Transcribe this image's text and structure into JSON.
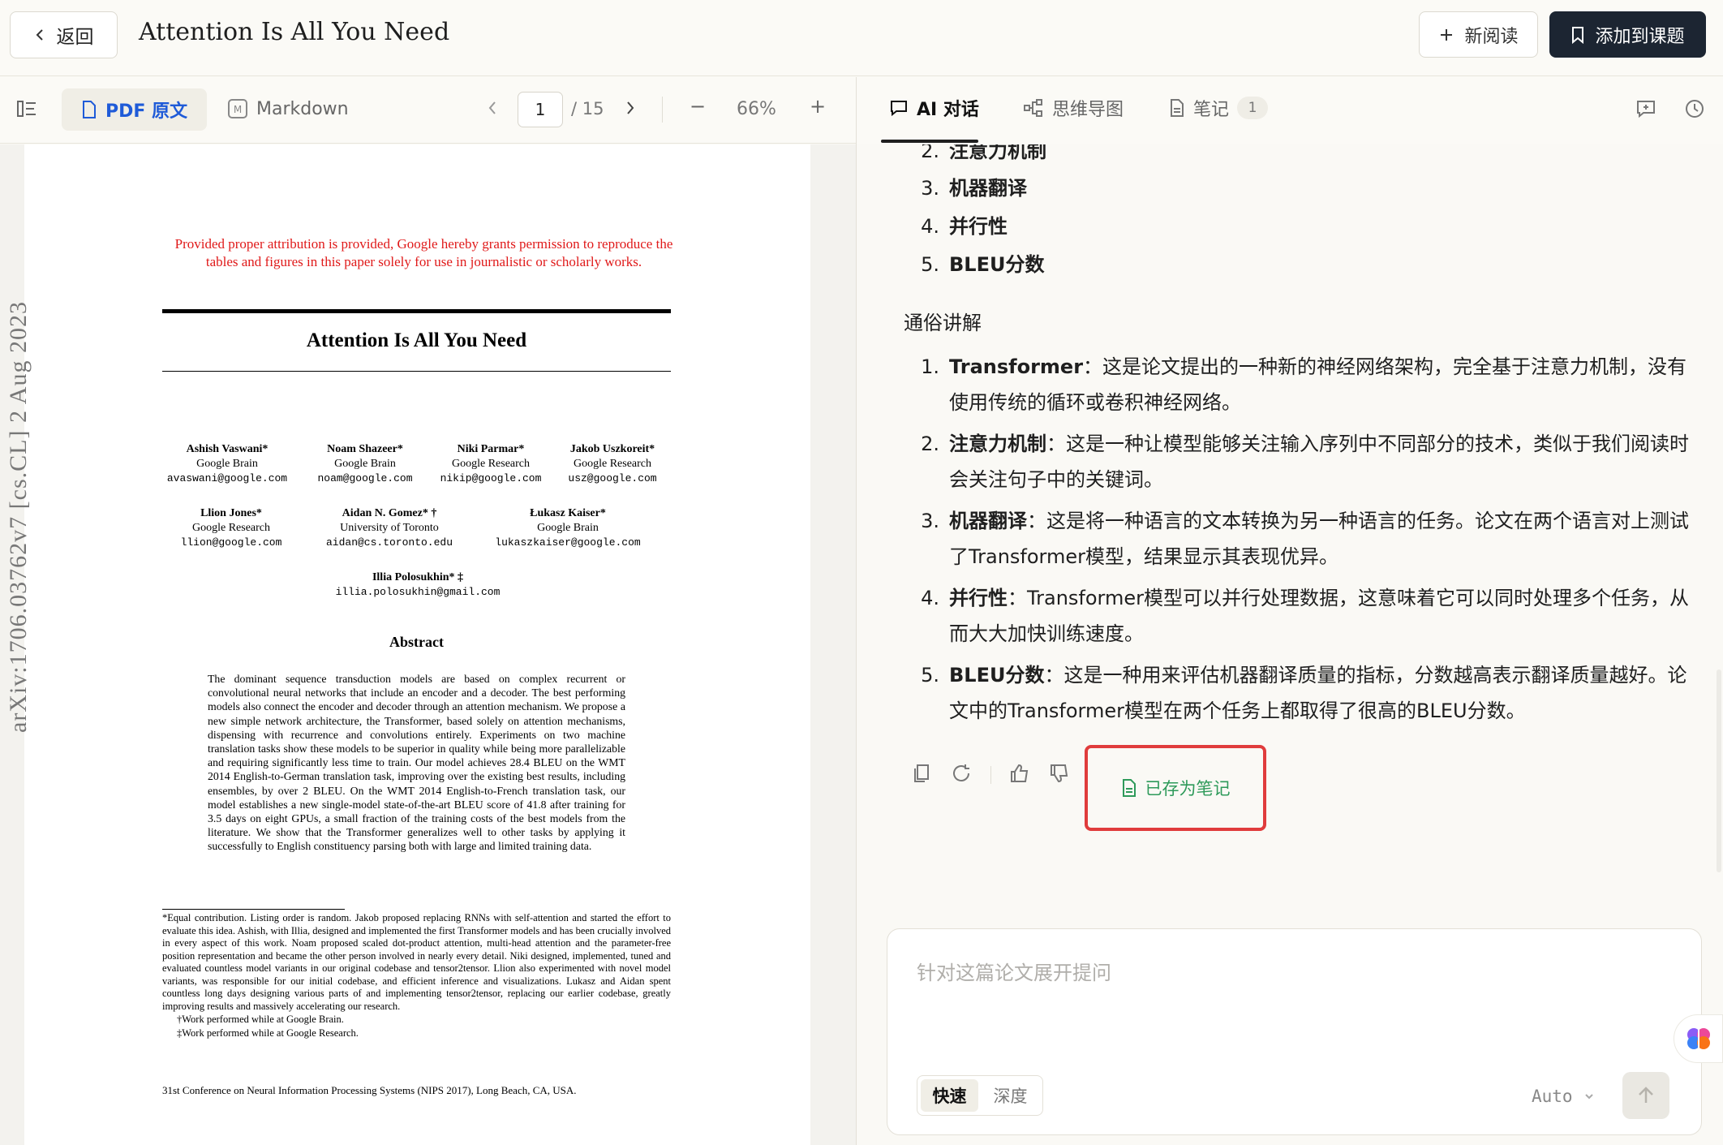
{
  "header": {
    "back_label": "返回",
    "title": "Attention Is All You Need",
    "new_read_label": "新阅读",
    "add_topic_label": "添加到课题"
  },
  "pdf_toolbar": {
    "pdf_tab": "PDF 原文",
    "markdown_tab": "Markdown",
    "page_current": "1",
    "page_total": "/ 15",
    "zoom": "66%",
    "zoom_out": "−",
    "zoom_in": "+"
  },
  "paper": {
    "arxiv": "arXiv:1706.03762v7  [cs.CL]  2 Aug 2023",
    "notice": "Provided proper attribution is provided, Google hereby grants permission to reproduce the tables and figures in this paper solely for use in journalistic or scholarly works.",
    "title": "Attention Is All You Need",
    "authors": [
      {
        "name": "Ashish Vaswani*",
        "org": "Google Brain",
        "email": "avaswani@google.com"
      },
      {
        "name": "Noam Shazeer*",
        "org": "Google Brain",
        "email": "noam@google.com"
      },
      {
        "name": "Niki Parmar*",
        "org": "Google Research",
        "email": "nikip@google.com"
      },
      {
        "name": "Jakob Uszkoreit*",
        "org": "Google Research",
        "email": "usz@google.com"
      },
      {
        "name": "Llion Jones*",
        "org": "Google Research",
        "email": "llion@google.com"
      },
      {
        "name": "Aidan N. Gomez* †",
        "org": "University of Toronto",
        "email": "aidan@cs.toronto.edu"
      },
      {
        "name": "Łukasz Kaiser*",
        "org": "Google Brain",
        "email": "lukaszkaiser@google.com"
      },
      {
        "name": "Illia Polosukhin* ‡",
        "org": "",
        "email": "illia.polosukhin@gmail.com"
      }
    ],
    "abstract_heading": "Abstract",
    "abstract": "The dominant sequence transduction models are based on complex recurrent or convolutional neural networks that include an encoder and a decoder. The best performing models also connect the encoder and decoder through an attention mechanism. We propose a new simple network architecture, the Transformer, based solely on attention mechanisms, dispensing with recurrence and convolutions entirely. Experiments on two machine translation tasks show these models to be superior in quality while being more parallelizable and requiring significantly less time to train. Our model achieves 28.4 BLEU on the WMT 2014 English-to-German translation task, improving over the existing best results, including ensembles, by over 2 BLEU. On the WMT 2014 English-to-French translation task, our model establishes a new single-model state-of-the-art BLEU score of 41.8 after training for 3.5 days on eight GPUs, a small fraction of the training costs of the best models from the literature. We show that the Transformer generalizes well to other tasks by applying it successfully to English constituency parsing both with large and limited training data.",
    "footnote_main": "*Equal contribution. Listing order is random. Jakob proposed replacing RNNs with self-attention and started the effort to evaluate this idea. Ashish, with Illia, designed and implemented the first Transformer models and has been crucially involved in every aspect of this work. Noam proposed scaled dot-product attention, multi-head attention and the parameter-free position representation and became the other person involved in nearly every detail. Niki designed, implemented, tuned and evaluated countless model variants in our original codebase and tensor2tensor. Llion also experimented with novel model variants, was responsible for our initial codebase, and efficient inference and visualizations. Lukasz and Aidan spent countless long days designing various parts of and implementing tensor2tensor, replacing our earlier codebase, greatly improving results and massively accelerating our research.",
    "footnote_dagger": "†Work performed while at Google Brain.",
    "footnote_ddagger": "‡Work performed while at Google Research.",
    "conference": "31st Conference on Neural Information Processing Systems (NIPS 2017), Long Beach, CA, USA."
  },
  "right_tabs": {
    "chat": "AI 对话",
    "mindmap": "思维导图",
    "notes": "笔记",
    "notes_count": "1"
  },
  "chat": {
    "keywords": [
      {
        "num": "2.",
        "term": "注意力机制"
      },
      {
        "num": "3.",
        "term": "机器翻译"
      },
      {
        "num": "4.",
        "term": "并行性"
      },
      {
        "num": "5.",
        "term": "BLEU分数"
      }
    ],
    "section_title": "通俗讲解",
    "explanations": [
      {
        "num": "1.",
        "term": "Transformer",
        "text": "：这是论文提出的一种新的神经网络架构，完全基于注意力机制，没有使用传统的循环或卷积神经网络。"
      },
      {
        "num": "2.",
        "term": "注意力机制",
        "text": "：这是一种让模型能够关注输入序列中不同部分的技术，类似于我们阅读时会关注句子中的关键词。"
      },
      {
        "num": "3.",
        "term": "机器翻译",
        "text": "：这是将一种语言的文本转换为另一种语言的任务。论文在两个语言对上测试了Transformer模型，结果显示其表现优异。"
      },
      {
        "num": "4.",
        "term": "并行性",
        "text": "：Transformer模型可以并行处理数据，这意味着它可以同时处理多个任务，从而大大加快训练速度。"
      },
      {
        "num": "5.",
        "term": "BLEU分数",
        "text": "：这是一种用来评估机器翻译质量的指标，分数越高表示翻译质量越好。论文中的Transformer模型在两个任务上都取得了很高的BLEU分数。"
      }
    ],
    "saved_label": "已存为笔记"
  },
  "input": {
    "placeholder": "针对这篇论文展开提问",
    "mode_fast": "快速",
    "mode_deep": "深度",
    "model": "Auto"
  },
  "colors": {
    "primary_dark": "#1c2532",
    "accent_blue": "#1f5bd8",
    "saved_green": "#2e9a5a",
    "highlight_red": "#e03c3c",
    "notice_red": "#e01919"
  }
}
